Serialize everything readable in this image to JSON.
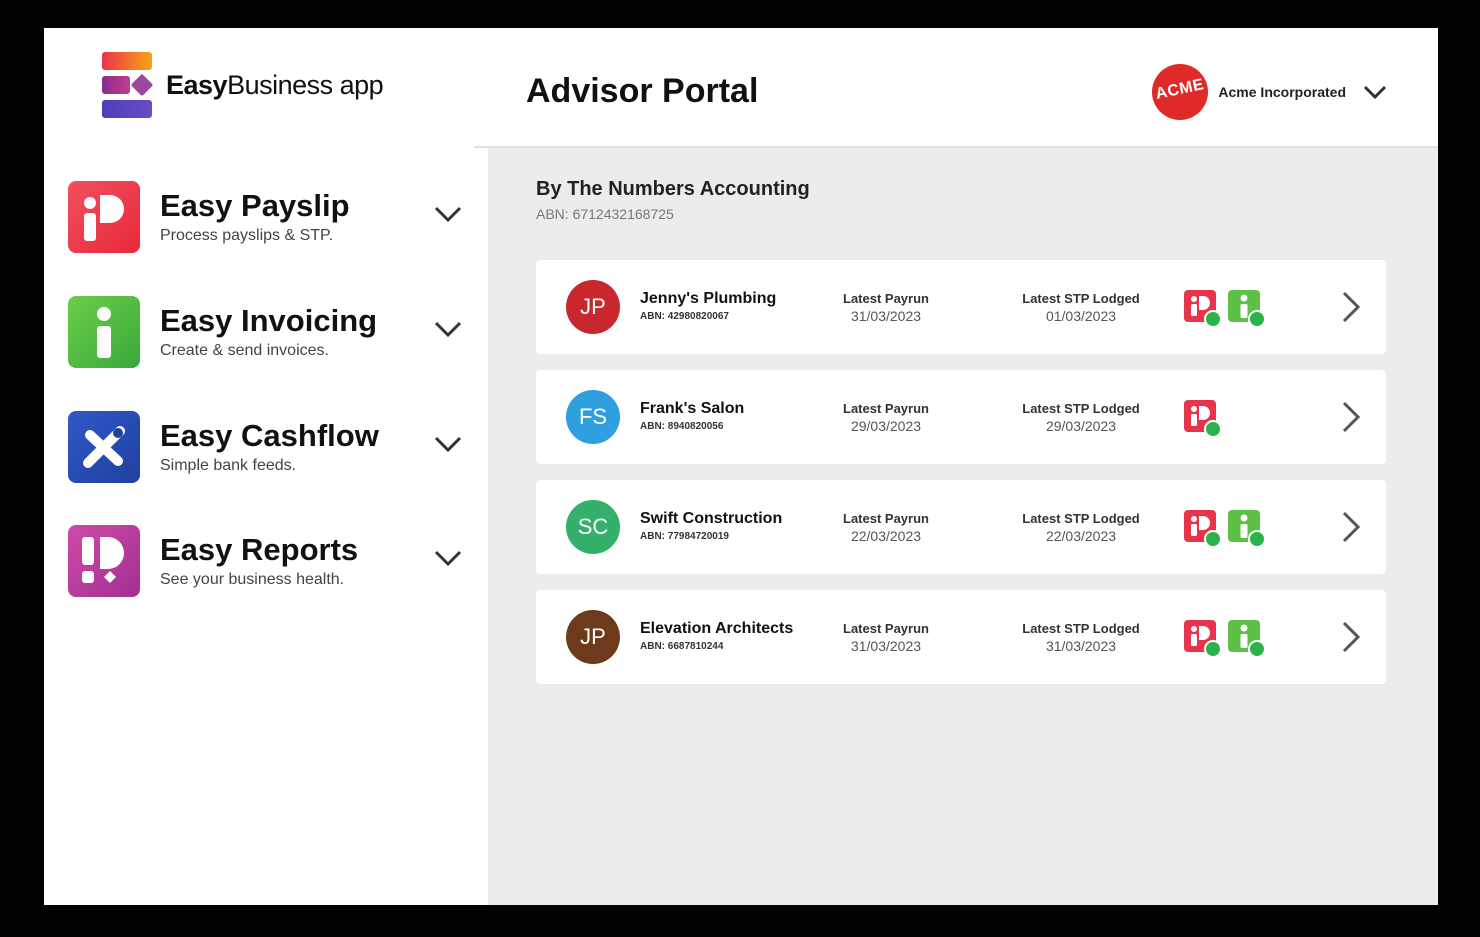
{
  "brand": {
    "name_bold": "Easy",
    "name_rest": "Business app"
  },
  "header": {
    "title": "Advisor Portal",
    "account_name": "Acme Incorporated",
    "account_logo_text": "ACME"
  },
  "sidebar": {
    "apps": [
      {
        "title": "Easy Payslip",
        "subtitle": "Process payslips & STP.",
        "icon": "payslip-app-icon",
        "color": "#e8344a"
      },
      {
        "title": "Easy Invoicing",
        "subtitle": "Create & send invoices.",
        "icon": "invoicing-app-icon",
        "color": "#4cb846"
      },
      {
        "title": "Easy Cashflow",
        "subtitle": "Simple bank feeds.",
        "icon": "cashflow-app-icon",
        "color": "#2a4fb8"
      },
      {
        "title": "Easy Reports",
        "subtitle": "See your business health.",
        "icon": "reports-app-icon",
        "color": "#b83898"
      }
    ]
  },
  "main": {
    "org_name": "By The Numbers Accounting",
    "org_abn": "ABN: 6712432168725",
    "payrun_label": "Latest Payrun",
    "stp_label": "Latest STP Lodged",
    "clients": [
      {
        "initials": "JP",
        "name": "Jenny's Plumbing",
        "abn": "ABN: 42980820067",
        "payrun": "31/03/2023",
        "stp": "01/03/2023",
        "avatar_color": "#c8282d",
        "apps": [
          "payslip",
          "invoicing"
        ]
      },
      {
        "initials": "FS",
        "name": "Frank's Salon",
        "abn": "ABN: 8940820056",
        "payrun": "29/03/2023",
        "stp": "29/03/2023",
        "avatar_color": "#2ea0e0",
        "apps": [
          "payslip"
        ]
      },
      {
        "initials": "SC",
        "name": "Swift Construction",
        "abn": "ABN: 77984720019",
        "payrun": "22/03/2023",
        "stp": "22/03/2023",
        "avatar_color": "#33b06a",
        "apps": [
          "payslip",
          "invoicing"
        ]
      },
      {
        "initials": "JP",
        "name": "Elevation Architects",
        "abn": "ABN: 6687810244",
        "payrun": "31/03/2023",
        "stp": "31/03/2023",
        "avatar_color": "#6e3a1c",
        "apps": [
          "payslip",
          "invoicing"
        ]
      }
    ]
  }
}
